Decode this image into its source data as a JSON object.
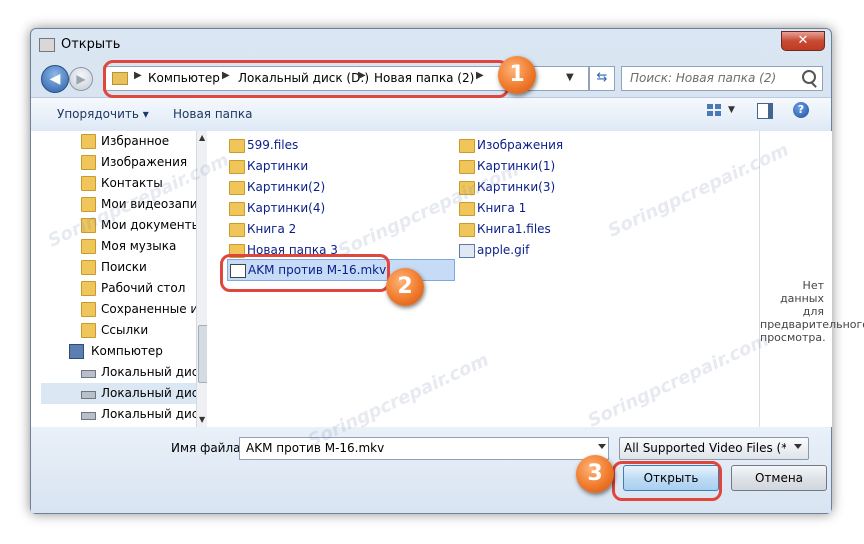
{
  "window": {
    "title": "Открыть",
    "close_label": "✕"
  },
  "address": {
    "crumbs": [
      "Компьютер",
      "Локальный диск (D:)",
      "Новая папка (2)"
    ],
    "search_placeholder": "Поиск: Новая папка (2)"
  },
  "toolbar": {
    "organize": "Упорядочить ▾",
    "new_folder": "Новая папка"
  },
  "sidebar": {
    "items": [
      {
        "label": "Избранное",
        "icon": "star-folder-icon"
      },
      {
        "label": "Изображения",
        "icon": "folder-icon"
      },
      {
        "label": "Контакты",
        "icon": "folder-icon"
      },
      {
        "label": "Мои видеозаписи",
        "icon": "folder-icon"
      },
      {
        "label": "Мои документы",
        "icon": "folder-icon"
      },
      {
        "label": "Моя музыка",
        "icon": "folder-icon"
      },
      {
        "label": "Поиски",
        "icon": "folder-icon"
      },
      {
        "label": "Рабочий стол",
        "icon": "folder-icon"
      },
      {
        "label": "Сохраненные игры",
        "icon": "folder-icon"
      },
      {
        "label": "Ссылки",
        "icon": "folder-icon"
      },
      {
        "label": "Компьютер",
        "icon": "computer-icon"
      },
      {
        "label": "Локальный диск",
        "icon": "drive-icon"
      },
      {
        "label": "Локальный диск",
        "icon": "drive-icon"
      },
      {
        "label": "Локальный диск",
        "icon": "drive-icon"
      }
    ]
  },
  "files": {
    "col1": [
      {
        "label": "599.files",
        "type": "folder"
      },
      {
        "label": "Картинки",
        "type": "folder"
      },
      {
        "label": "Картинки(2)",
        "type": "folder"
      },
      {
        "label": "Картинки(4)",
        "type": "folder"
      },
      {
        "label": "Книга 2",
        "type": "folder"
      },
      {
        "label": "Новая папка 3",
        "type": "folder"
      }
    ],
    "col2": [
      {
        "label": "Изображения",
        "type": "folder"
      },
      {
        "label": "Картинки(1)",
        "type": "folder"
      },
      {
        "label": "Картинки(3)",
        "type": "folder"
      },
      {
        "label": "Книга 1",
        "type": "folder"
      },
      {
        "label": "Книга1.files",
        "type": "folder"
      },
      {
        "label": "apple.gif",
        "type": "gif"
      }
    ],
    "selected": {
      "label": "AKM против M-16.mkv",
      "type": "video"
    }
  },
  "preview": {
    "text": "Нет данных для предварительного просмотра."
  },
  "bottom": {
    "filename_label": "Имя файла:",
    "filename_value": "AKM против M-16.mkv",
    "filter_value": "All Supported Video Files (*.rm;",
    "open_button": "Открыть",
    "cancel_button": "Отмена"
  },
  "annotations": {
    "badge1": "1",
    "badge2": "2",
    "badge3": "3"
  },
  "watermark": "Soringpcrepair.com",
  "colors": {
    "highlight": "#e0463c",
    "badge": "#f07a2b",
    "selection": "#c6dcf6"
  }
}
